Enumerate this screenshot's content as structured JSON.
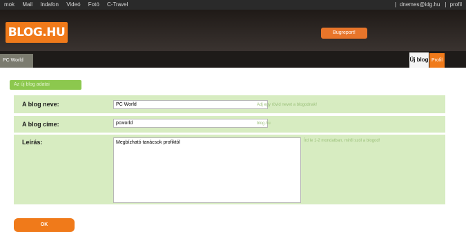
{
  "topbar": {
    "links": [
      "mok",
      "Mail",
      "Indafon",
      "Videó",
      "Fotó",
      "C-Travel"
    ],
    "user": "dnemes@idg.hu",
    "profile": "profil"
  },
  "header": {
    "logo": "BLOG.HU",
    "bugreport": "Bugreport!"
  },
  "tabs": {
    "left": "PC World",
    "new_blog": "Új blog",
    "profile": "Profil"
  },
  "form": {
    "legend": "Az új blog adatai",
    "fields": [
      {
        "label": "A blog neve:",
        "value": "PC World",
        "hint": "Adj egy rövid nevet a blogodnak!"
      },
      {
        "label": "A blog címe:",
        "value": "pcworld",
        "hint": "blog.hu"
      },
      {
        "label": "Leírás:",
        "value": "Megbízható tanácsok profiktól",
        "hint": "Írd le 1-2 mondatban, miről szól a blogod!"
      }
    ],
    "ok": "OK"
  }
}
